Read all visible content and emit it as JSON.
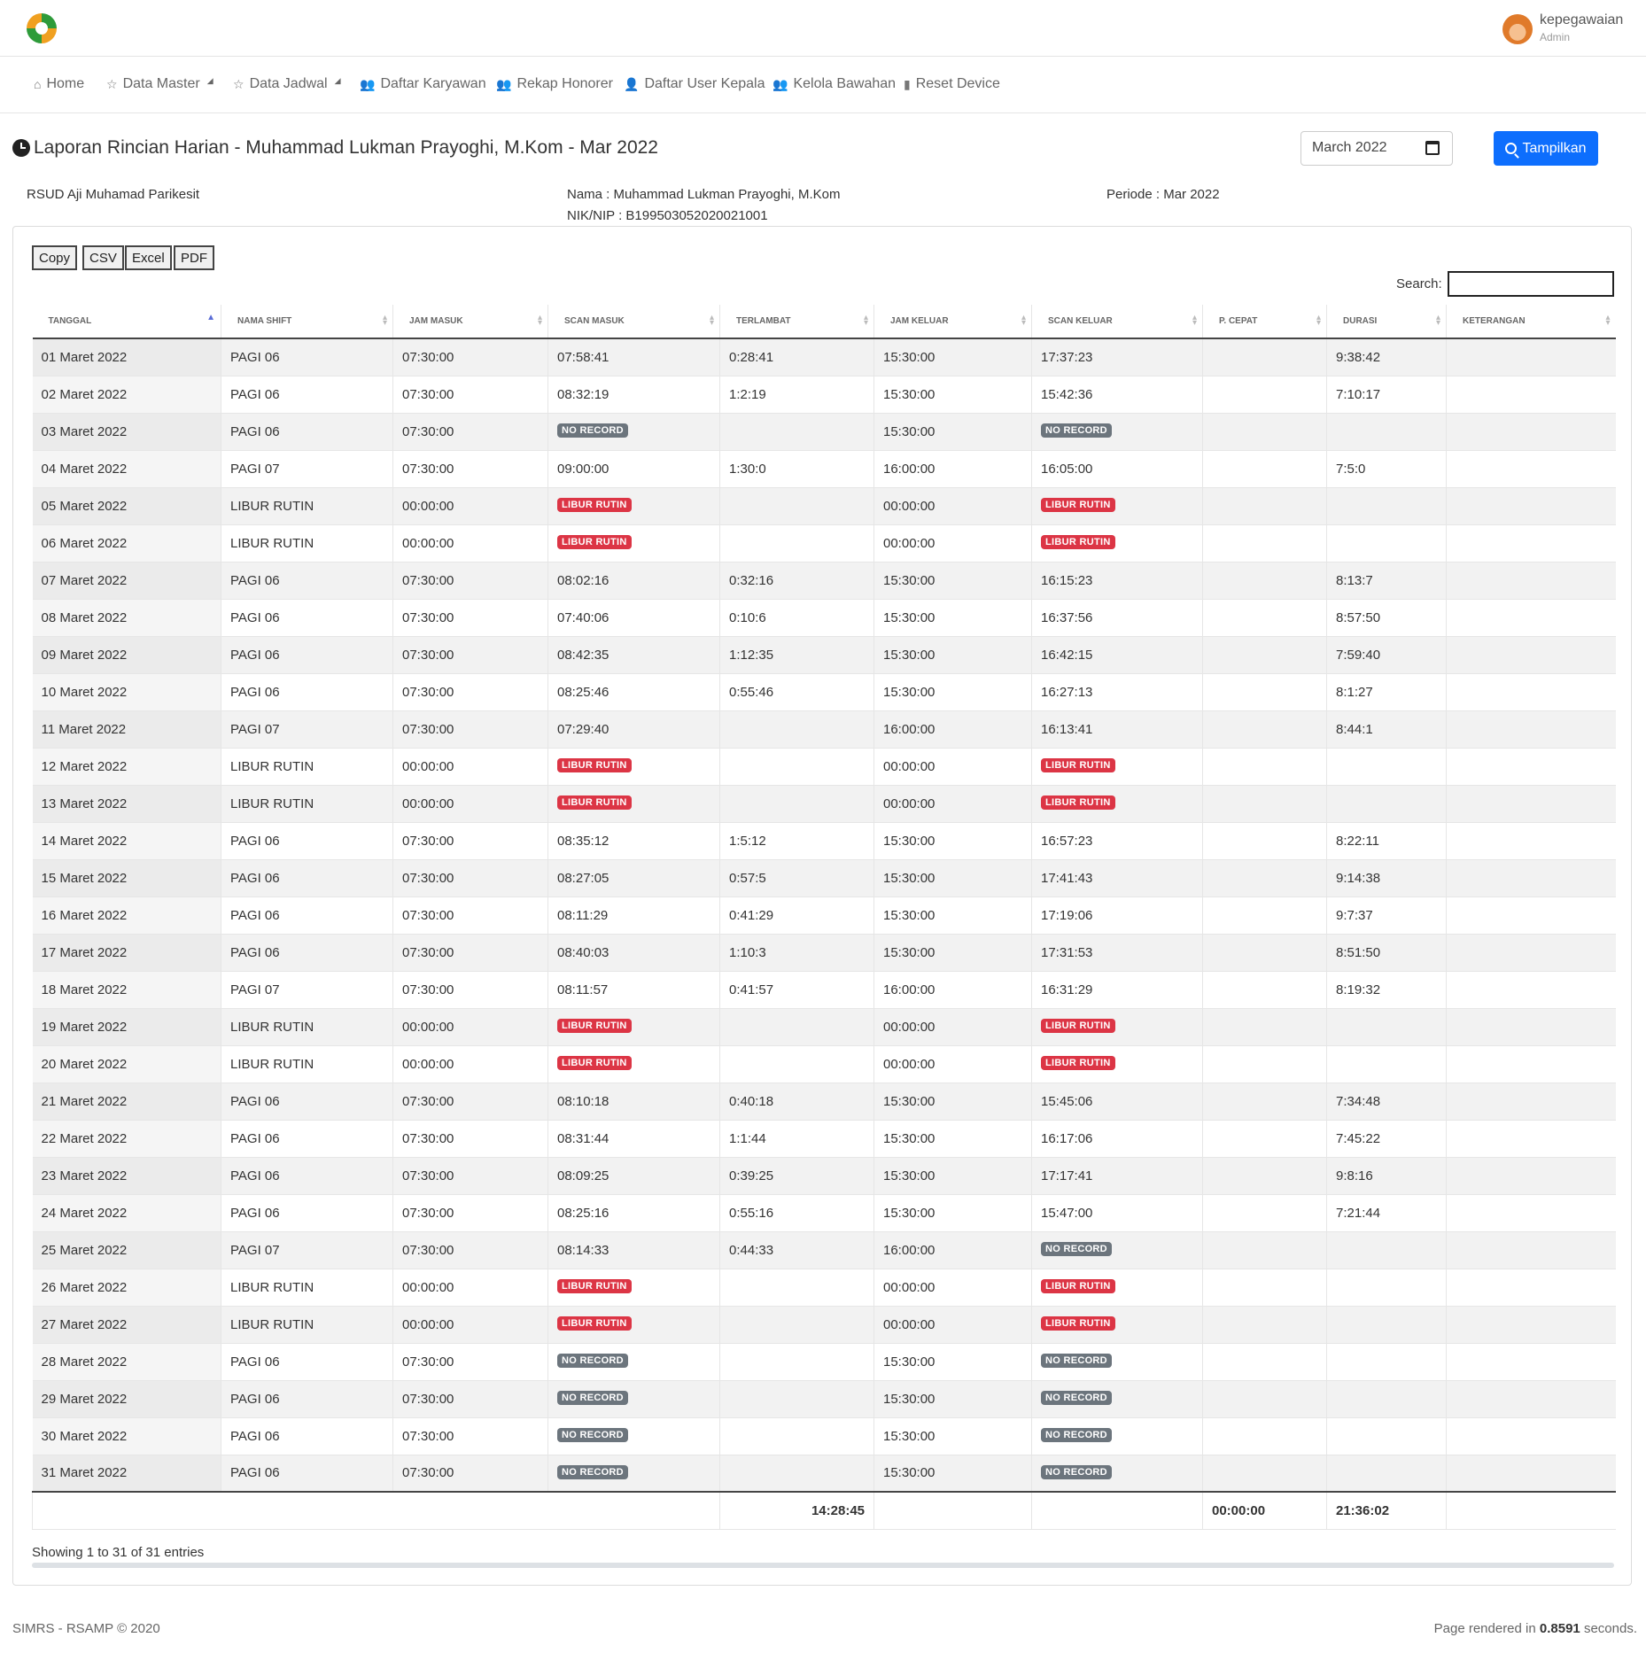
{
  "header": {
    "user_name": "kepegawaian",
    "user_role": "Admin"
  },
  "nav": [
    {
      "label": "Home",
      "icon": "home-icon",
      "glyph": "⌂"
    },
    {
      "label": "Data Master",
      "icon": "star-icon",
      "glyph": "☆",
      "caret": "◢"
    },
    {
      "label": "Data Jadwal",
      "icon": "star-icon",
      "glyph": "☆",
      "caret": "◢"
    },
    {
      "label": "Daftar Karyawan",
      "icon": "users-icon",
      "glyph": "👥"
    },
    {
      "label": "Rekap Honorer",
      "icon": "users-icon",
      "glyph": "👥"
    },
    {
      "label": "Daftar User Kepala",
      "icon": "user-cog-icon",
      "glyph": "👤"
    },
    {
      "label": "Kelola Bawahan",
      "icon": "users-icon",
      "glyph": "👥"
    },
    {
      "label": "Reset Device",
      "icon": "mobile-icon",
      "glyph": "▮"
    }
  ],
  "page": {
    "title": "Laporan Rincian Harian - Muhammad Lukman Prayoghi, M.Kom - Mar 2022",
    "month_value": "March 2022",
    "show_button": "Tampilkan"
  },
  "info": {
    "unit": "RSUD Aji Muhamad Parikesit",
    "nama": "Nama : Muhammad Lukman Prayoghi, M.Kom",
    "nik": "NIK/NIP : B199503052020021001",
    "periode": "Periode : Mar 2022"
  },
  "export_buttons": [
    "Copy",
    "CSV",
    "Excel",
    "PDF"
  ],
  "search_label": "Search:",
  "table": {
    "columns": [
      "TANGGAL",
      "NAMA SHIFT",
      "JAM MASUK",
      "SCAN MASUK",
      "TERLAMBAT",
      "JAM KELUAR",
      "SCAN KELUAR",
      "P. CEPAT",
      "DURASI",
      "KETERANGAN"
    ],
    "rows": [
      [
        "01 Maret 2022",
        "PAGI 06",
        "07:30:00",
        "07:58:41",
        "0:28:41",
        "15:30:00",
        "17:37:23",
        "",
        "9:38:42",
        ""
      ],
      [
        "02 Maret 2022",
        "PAGI 06",
        "07:30:00",
        "08:32:19",
        "1:2:19",
        "15:30:00",
        "15:42:36",
        "",
        "7:10:17",
        ""
      ],
      [
        "03 Maret 2022",
        "PAGI 06",
        "07:30:00",
        "NO RECORD",
        "",
        "15:30:00",
        "NO RECORD",
        "",
        "",
        ""
      ],
      [
        "04 Maret 2022",
        "PAGI 07",
        "07:30:00",
        "09:00:00",
        "1:30:0",
        "16:00:00",
        "16:05:00",
        "",
        "7:5:0",
        ""
      ],
      [
        "05 Maret 2022",
        "LIBUR RUTIN",
        "00:00:00",
        "LIBUR RUTIN",
        "",
        "00:00:00",
        "LIBUR RUTIN",
        "",
        "",
        ""
      ],
      [
        "06 Maret 2022",
        "LIBUR RUTIN",
        "00:00:00",
        "LIBUR RUTIN",
        "",
        "00:00:00",
        "LIBUR RUTIN",
        "",
        "",
        ""
      ],
      [
        "07 Maret 2022",
        "PAGI 06",
        "07:30:00",
        "08:02:16",
        "0:32:16",
        "15:30:00",
        "16:15:23",
        "",
        "8:13:7",
        ""
      ],
      [
        "08 Maret 2022",
        "PAGI 06",
        "07:30:00",
        "07:40:06",
        "0:10:6",
        "15:30:00",
        "16:37:56",
        "",
        "8:57:50",
        ""
      ],
      [
        "09 Maret 2022",
        "PAGI 06",
        "07:30:00",
        "08:42:35",
        "1:12:35",
        "15:30:00",
        "16:42:15",
        "",
        "7:59:40",
        ""
      ],
      [
        "10 Maret 2022",
        "PAGI 06",
        "07:30:00",
        "08:25:46",
        "0:55:46",
        "15:30:00",
        "16:27:13",
        "",
        "8:1:27",
        ""
      ],
      [
        "11 Maret 2022",
        "PAGI 07",
        "07:30:00",
        "07:29:40",
        "",
        "16:00:00",
        "16:13:41",
        "",
        "8:44:1",
        ""
      ],
      [
        "12 Maret 2022",
        "LIBUR RUTIN",
        "00:00:00",
        "LIBUR RUTIN",
        "",
        "00:00:00",
        "LIBUR RUTIN",
        "",
        "",
        ""
      ],
      [
        "13 Maret 2022",
        "LIBUR RUTIN",
        "00:00:00",
        "LIBUR RUTIN",
        "",
        "00:00:00",
        "LIBUR RUTIN",
        "",
        "",
        ""
      ],
      [
        "14 Maret 2022",
        "PAGI 06",
        "07:30:00",
        "08:35:12",
        "1:5:12",
        "15:30:00",
        "16:57:23",
        "",
        "8:22:11",
        ""
      ],
      [
        "15 Maret 2022",
        "PAGI 06",
        "07:30:00",
        "08:27:05",
        "0:57:5",
        "15:30:00",
        "17:41:43",
        "",
        "9:14:38",
        ""
      ],
      [
        "16 Maret 2022",
        "PAGI 06",
        "07:30:00",
        "08:11:29",
        "0:41:29",
        "15:30:00",
        "17:19:06",
        "",
        "9:7:37",
        ""
      ],
      [
        "17 Maret 2022",
        "PAGI 06",
        "07:30:00",
        "08:40:03",
        "1:10:3",
        "15:30:00",
        "17:31:53",
        "",
        "8:51:50",
        ""
      ],
      [
        "18 Maret 2022",
        "PAGI 07",
        "07:30:00",
        "08:11:57",
        "0:41:57",
        "16:00:00",
        "16:31:29",
        "",
        "8:19:32",
        ""
      ],
      [
        "19 Maret 2022",
        "LIBUR RUTIN",
        "00:00:00",
        "LIBUR RUTIN",
        "",
        "00:00:00",
        "LIBUR RUTIN",
        "",
        "",
        ""
      ],
      [
        "20 Maret 2022",
        "LIBUR RUTIN",
        "00:00:00",
        "LIBUR RUTIN",
        "",
        "00:00:00",
        "LIBUR RUTIN",
        "",
        "",
        ""
      ],
      [
        "21 Maret 2022",
        "PAGI 06",
        "07:30:00",
        "08:10:18",
        "0:40:18",
        "15:30:00",
        "15:45:06",
        "",
        "7:34:48",
        ""
      ],
      [
        "22 Maret 2022",
        "PAGI 06",
        "07:30:00",
        "08:31:44",
        "1:1:44",
        "15:30:00",
        "16:17:06",
        "",
        "7:45:22",
        ""
      ],
      [
        "23 Maret 2022",
        "PAGI 06",
        "07:30:00",
        "08:09:25",
        "0:39:25",
        "15:30:00",
        "17:17:41",
        "",
        "9:8:16",
        ""
      ],
      [
        "24 Maret 2022",
        "PAGI 06",
        "07:30:00",
        "08:25:16",
        "0:55:16",
        "15:30:00",
        "15:47:00",
        "",
        "7:21:44",
        ""
      ],
      [
        "25 Maret 2022",
        "PAGI 07",
        "07:30:00",
        "08:14:33",
        "0:44:33",
        "16:00:00",
        "NO RECORD",
        "",
        "",
        ""
      ],
      [
        "26 Maret 2022",
        "LIBUR RUTIN",
        "00:00:00",
        "LIBUR RUTIN",
        "",
        "00:00:00",
        "LIBUR RUTIN",
        "",
        "",
        ""
      ],
      [
        "27 Maret 2022",
        "LIBUR RUTIN",
        "00:00:00",
        "LIBUR RUTIN",
        "",
        "00:00:00",
        "LIBUR RUTIN",
        "",
        "",
        ""
      ],
      [
        "28 Maret 2022",
        "PAGI 06",
        "07:30:00",
        "NO RECORD",
        "",
        "15:30:00",
        "NO RECORD",
        "",
        "",
        ""
      ],
      [
        "29 Maret 2022",
        "PAGI 06",
        "07:30:00",
        "NO RECORD",
        "",
        "15:30:00",
        "NO RECORD",
        "",
        "",
        ""
      ],
      [
        "30 Maret 2022",
        "PAGI 06",
        "07:30:00",
        "NO RECORD",
        "",
        "15:30:00",
        "NO RECORD",
        "",
        "",
        ""
      ],
      [
        "31 Maret 2022",
        "PAGI 06",
        "07:30:00",
        "NO RECORD",
        "",
        "15:30:00",
        "NO RECORD",
        "",
        "",
        ""
      ]
    ],
    "totals": {
      "terlambat": "14:28:45",
      "p_cepat": "00:00:00",
      "durasi": "21:36:02"
    }
  },
  "badges": {
    "NO RECORD": "#6c757d",
    "LIBUR RUTIN": "#dc3545"
  },
  "showing_text": "Showing 1 to 31 of 31 entries",
  "footer": {
    "left": "SIMRS - RSAMP © 2020",
    "right_prefix": "Page rendered in",
    "render_time": "0.8591",
    "right_suffix": "seconds."
  }
}
